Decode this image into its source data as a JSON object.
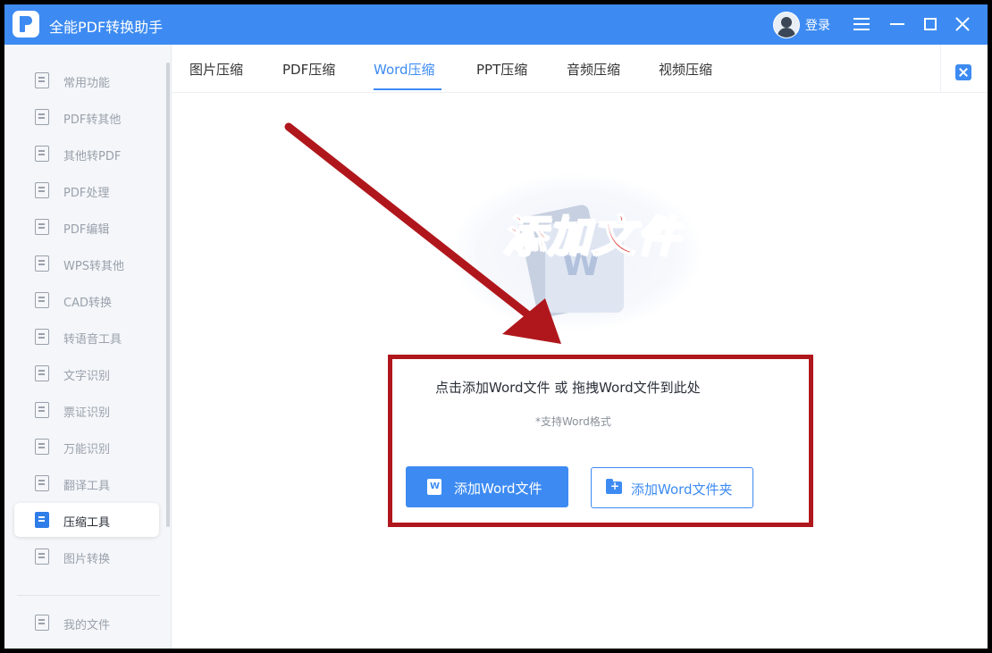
{
  "titlebar": {
    "app_title": "全能PDF转换助手",
    "login_label": "登录"
  },
  "sidebar": {
    "items": [
      {
        "label": "常用功能",
        "icon": "star-grid-icon"
      },
      {
        "label": "PDF转其他",
        "icon": "pdf-export-icon"
      },
      {
        "label": "其他转PDF",
        "icon": "pdf-import-icon"
      },
      {
        "label": "PDF处理",
        "icon": "pdf-process-icon"
      },
      {
        "label": "PDF编辑",
        "icon": "pdf-edit-icon"
      },
      {
        "label": "WPS转其他",
        "icon": "wps-icon"
      },
      {
        "label": "CAD转换",
        "icon": "cad-icon"
      },
      {
        "label": "转语音工具",
        "icon": "audio-icon"
      },
      {
        "label": "文字识别",
        "icon": "ocr-icon"
      },
      {
        "label": "票证识别",
        "icon": "ticket-icon"
      },
      {
        "label": "万能识别",
        "icon": "scan-icon"
      },
      {
        "label": "翻译工具",
        "icon": "translate-icon"
      },
      {
        "label": "压缩工具",
        "icon": "compress-icon",
        "active": true
      },
      {
        "label": "图片转换",
        "icon": "image-icon"
      }
    ],
    "my_files": {
      "label": "我的文件",
      "icon": "file-icon"
    }
  },
  "tabs": [
    {
      "label": "图片压缩"
    },
    {
      "label": "PDF压缩"
    },
    {
      "label": "Word压缩",
      "active": true
    },
    {
      "label": "PPT压缩"
    },
    {
      "label": "音频压缩"
    },
    {
      "label": "视频压缩"
    }
  ],
  "main": {
    "overlay_title": "添加文件",
    "doc_letter": "W",
    "drop_hint": "点击添加Word文件 或 拖拽Word文件到此处",
    "format_note": "*支持Word格式",
    "add_file_button": "添加Word文件",
    "add_folder_button": "添加Word文件夹"
  },
  "colors": {
    "accent": "#3d8bf2",
    "annotation_red": "#b0171c"
  }
}
